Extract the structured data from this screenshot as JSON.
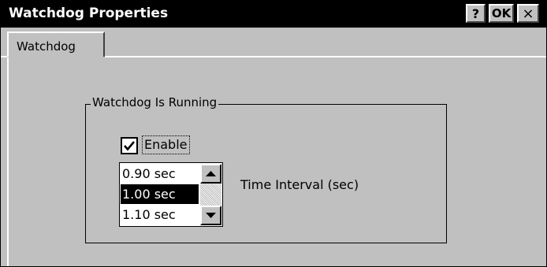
{
  "window": {
    "title": "Watchdog Properties",
    "help_label": "?",
    "ok_label": "OK",
    "close_label": "×"
  },
  "tabs": [
    {
      "label": "Watchdog",
      "active": true
    }
  ],
  "group": {
    "title": "Watchdog Is Running"
  },
  "enable": {
    "label": "Enable",
    "checked": true
  },
  "interval": {
    "label": "Time Interval (sec)",
    "options": [
      "0.90 sec",
      "1.00 sec",
      "1.10 sec"
    ],
    "selected": "1.00 sec",
    "up_icon": "up-arrow-icon",
    "down_icon": "down-arrow-icon"
  }
}
